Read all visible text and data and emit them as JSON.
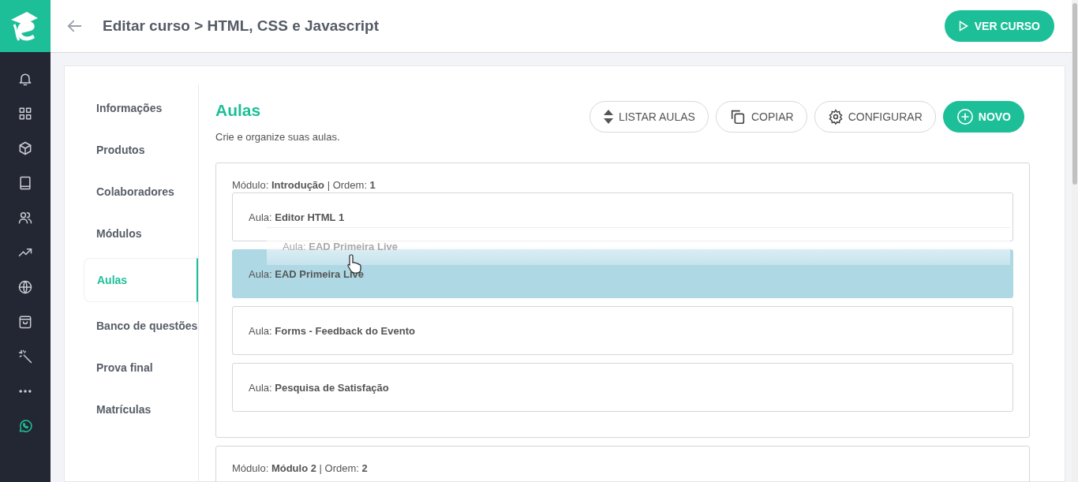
{
  "header": {
    "title": "Editar curso > HTML, CSS e Javascript",
    "view_button": "VER CURSO"
  },
  "nav": [
    {
      "label": "Informações",
      "selected": false
    },
    {
      "label": "Produtos",
      "selected": false
    },
    {
      "label": "Colaboradores",
      "selected": false
    },
    {
      "label": "Módulos",
      "selected": false
    },
    {
      "label": "Aulas",
      "selected": true
    },
    {
      "label": "Banco de questões",
      "selected": false
    },
    {
      "label": "Prova final",
      "selected": false
    },
    {
      "label": "Matrículas",
      "selected": false
    }
  ],
  "section": {
    "title": "Aulas",
    "subtitle": "Crie e organize suas aulas."
  },
  "actions": [
    {
      "kind": "sort",
      "label": "LISTAR AULAS"
    },
    {
      "kind": "copy",
      "label": "COPIAR"
    },
    {
      "kind": "settings",
      "label": "CONFIGURAR"
    },
    {
      "kind": "add",
      "label": "NOVO"
    }
  ],
  "modules": [
    {
      "heading": "Módulo: **Introdução** | Ordem: **1**",
      "drag_ghost": "Aula: **EAD Primeira Live**",
      "lessons": [
        {
          "title": "Aula: **Editor HTML 1**",
          "highlighted": false
        },
        {
          "title": "Aula: **EAD Primeira Live**",
          "highlighted": true
        },
        {
          "title": "Aula: **Forms - Feedback do Evento**",
          "highlighted": false
        },
        {
          "title": "Aula: **Pesquisa de Satisfação**",
          "highlighted": false
        }
      ]
    },
    {
      "heading": "Módulo: **Módulo 2** | Ordem: **2**"
    }
  ]
}
